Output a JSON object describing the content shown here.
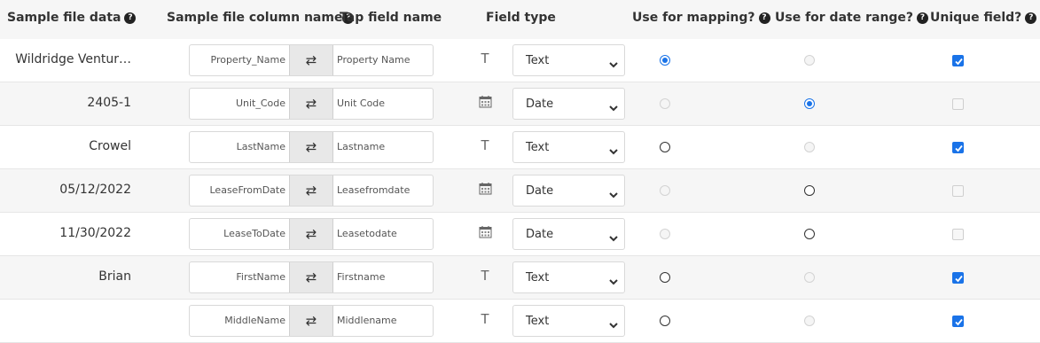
{
  "headers": {
    "sample": "Sample file data",
    "column": "Sample file column name",
    "tap": "Tap field name",
    "type": "Field type",
    "mapping": "Use for mapping?",
    "daterange": "Use for date range?",
    "unique": "Unique field?",
    "help": "?"
  },
  "swap_glyph": "⇄",
  "rows": [
    {
      "sample": "Wildridge Ventur…",
      "column": "Property_Name",
      "tap": "Property Name",
      "icon": "text-type-icon",
      "type": "Text",
      "mapping": "checked",
      "daterange": "disabled",
      "unique": true
    },
    {
      "sample": "2405-1",
      "column": "Unit_Code",
      "tap": "Unit Code",
      "icon": "calendar-icon",
      "type": "Date",
      "mapping": "disabled",
      "daterange": "checked",
      "unique": false
    },
    {
      "sample": "Crowel",
      "column": "LastName",
      "tap": "Lastname",
      "icon": "text-type-icon",
      "type": "Text",
      "mapping": "unchecked",
      "daterange": "disabled",
      "unique": true
    },
    {
      "sample": "05/12/2022",
      "column": "LeaseFromDate",
      "tap": "Leasefromdate",
      "icon": "calendar-icon",
      "type": "Date",
      "mapping": "disabled",
      "daterange": "unchecked",
      "unique": false
    },
    {
      "sample": "11/30/2022",
      "column": "LeaseToDate",
      "tap": "Leasetodate",
      "icon": "calendar-icon",
      "type": "Date",
      "mapping": "disabled",
      "daterange": "unchecked",
      "unique": false
    },
    {
      "sample": "Brian",
      "column": "FirstName",
      "tap": "Firstname",
      "icon": "text-type-icon",
      "type": "Text",
      "mapping": "unchecked",
      "daterange": "disabled",
      "unique": true
    },
    {
      "sample": "",
      "column": "MiddleName",
      "tap": "Middlename",
      "icon": "text-type-icon",
      "type": "Text",
      "mapping": "unchecked",
      "daterange": "disabled",
      "unique": true
    }
  ],
  "colors": {
    "accent": "#1a73e8",
    "row_alt": "#f6f6f6"
  }
}
